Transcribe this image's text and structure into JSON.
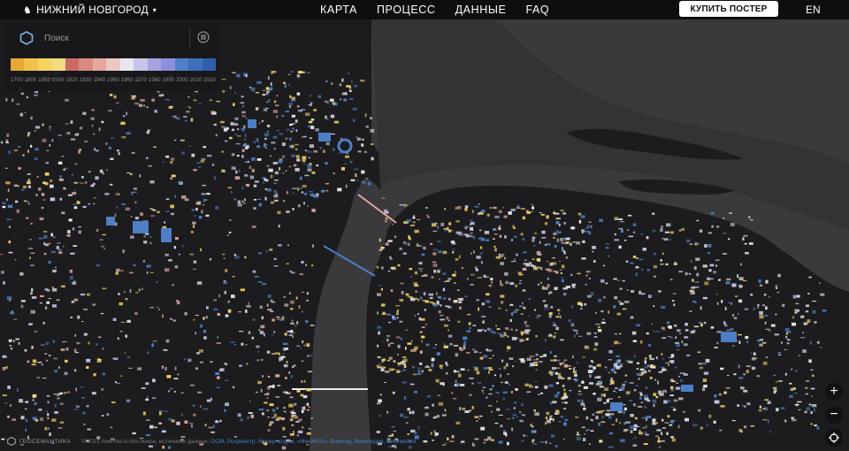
{
  "header": {
    "city": "НИЖНИЙ НОВГОРОД",
    "city_caret": "▾",
    "nav": [
      "КАРТА",
      "ПРОЦЕСС",
      "ДАННЫЕ",
      "FAQ"
    ],
    "buy_label": "КУПИТЬ ПОСТЕР",
    "lang": "EN"
  },
  "panel": {
    "search_placeholder": "Поиск",
    "legend_years": [
      "1700",
      "1800",
      "1850",
      "1900",
      "1920",
      "1930",
      "1940",
      "1950",
      "1960",
      "1970",
      "1980",
      "1990",
      "2000",
      "2010",
      "2020"
    ],
    "legend_colors": [
      "#e8a834",
      "#f0c24a",
      "#f5d35c",
      "#f2dc80",
      "#c96a66",
      "#d98882",
      "#e3a7a0",
      "#ecc8c4",
      "#e8e6f2",
      "#c7c5ea",
      "#a6a2de",
      "#8c8fdc",
      "#4f7fca",
      "#3e6fbd",
      "#2f5fac"
    ]
  },
  "controls": {
    "zoom_in": "+",
    "zoom_out": "−"
  },
  "footer": {
    "brand": "ГЕОСЕМАНТИКА",
    "copyright": "© 2021 how-old-is-this.house, источники данных: ",
    "sources": "ОСМ, Росреестр, Минкультуры, «МинЖКХ», Викигид, Википедия, Викимапия"
  },
  "map": {
    "colors": {
      "land": "#1c1c1e",
      "water": "#3a3a3d",
      "road": "#2a2a2d",
      "old": "#f2d468",
      "mid": "#e0a9a4",
      "new": "#4d7ec6",
      "pale": "#c9c6ee",
      "white": "#e9e9ee"
    }
  }
}
